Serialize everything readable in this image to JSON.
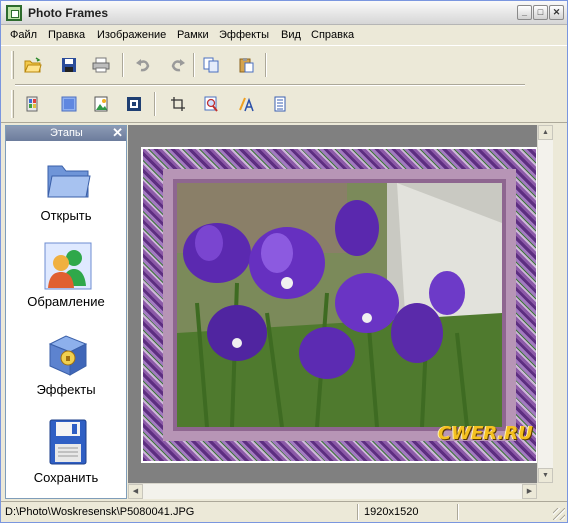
{
  "window": {
    "title": "Photo Frames"
  },
  "menu": [
    "Файл",
    "Правка",
    "Изображение",
    "Рамки",
    "Эффекты",
    "Вид",
    "Справка"
  ],
  "toolbar": {
    "row1": [
      "open-folder-icon",
      "save-disk-icon",
      "print-icon",
      "undo-icon",
      "redo-icon",
      "copy-icon",
      "paste-icon"
    ],
    "row2": [
      "layers-icon",
      "blue-square-icon",
      "image-icon",
      "frame-icon",
      "crop-icon",
      "image-search-icon",
      "text-icon",
      "document-icon"
    ]
  },
  "steps_panel": {
    "title": "Этапы",
    "close_glyph": "✕",
    "steps": [
      {
        "label": "Открыть",
        "icon": "folder-icon"
      },
      {
        "label": "Обрамление",
        "icon": "people-icon"
      },
      {
        "label": "Эффекты",
        "icon": "effects-box-icon"
      },
      {
        "label": "Сохранить",
        "icon": "floppy-disk-icon"
      }
    ]
  },
  "canvas": {
    "watermark": "CWER.RU"
  },
  "status": {
    "path": "D:\\Photo\\Woskresensk\\P5080041.JPG",
    "resolution": "1920x1520"
  },
  "colors": {
    "frame_purple": "#5d2e80",
    "mat": "#b795b6",
    "viewport": "#808080",
    "accent": "#ece9d8"
  }
}
